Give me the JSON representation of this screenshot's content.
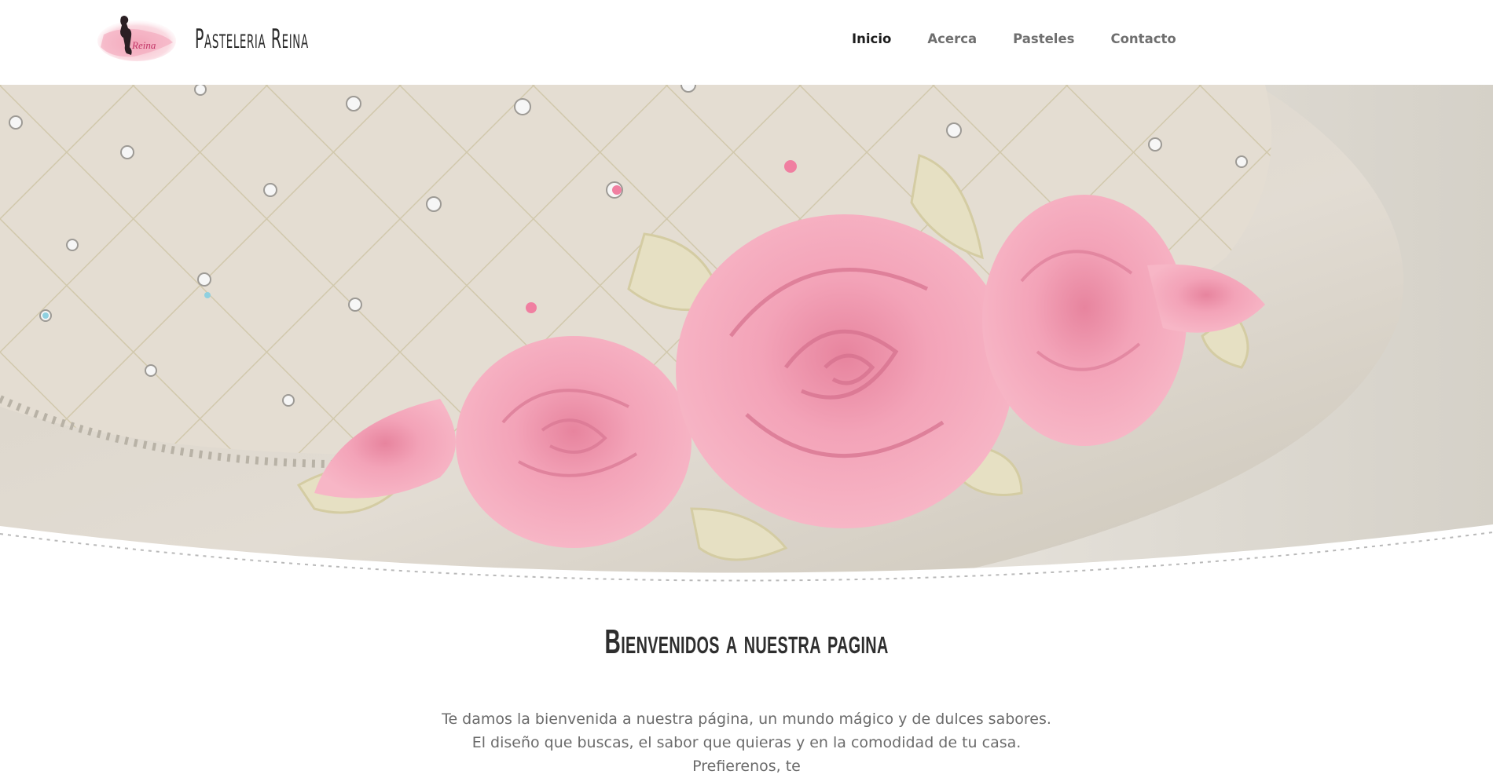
{
  "brand": {
    "name": "Pasteleria Reina",
    "logo_text": "Reina",
    "logo_icon": "silhouette-logo-icon"
  },
  "nav": {
    "items": [
      {
        "label": "Inicio",
        "active": true
      },
      {
        "label": "Acerca",
        "active": false
      },
      {
        "label": "Pasteles",
        "active": false
      },
      {
        "label": "Contacto",
        "active": false
      }
    ]
  },
  "hero": {
    "image": "pink-sugar-roses-cake"
  },
  "welcome": {
    "title": "Bienvenidos a nuestra pagina",
    "text": "Te damos la bienvenida a nuestra página, un mundo mágico y de dulces sabores. El diseño que buscas, el sabor que quieras y en la comodidad de tu casa. Prefierenos, te"
  },
  "colors": {
    "accent_pink": "#f29bb3",
    "text_dark": "#1c1c1c",
    "text_muted": "#6f6f6f"
  }
}
